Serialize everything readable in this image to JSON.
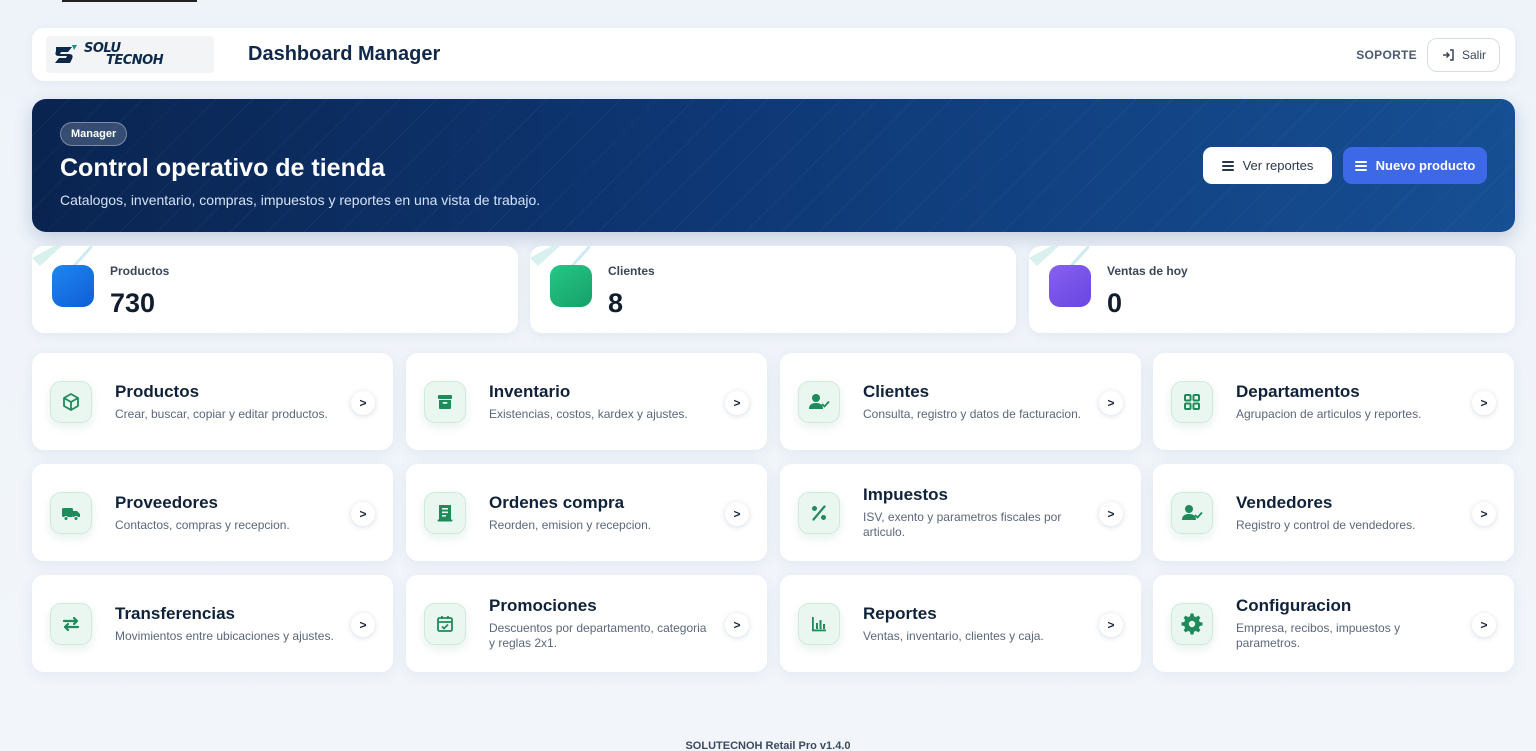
{
  "header": {
    "logo_text_line1": "SOLU",
    "logo_text_line2": "TECNOH",
    "title": "Dashboard Manager",
    "support_label": "SOPORTE",
    "logout_label": "Salir"
  },
  "hero": {
    "badge": "Manager",
    "title": "Control operativo de tienda",
    "subtitle": "Catalogos, inventario, compras, impuestos y reportes en una vista de trabajo.",
    "reports_button": "Ver reportes",
    "new_product_button": "Nuevo producto"
  },
  "stats": [
    {
      "label": "Productos",
      "value": "730",
      "color": "#1a73e8"
    },
    {
      "label": "Clientes",
      "value": "8",
      "color": "#1fb87a"
    },
    {
      "label": "Ventas de hoy",
      "value": "0",
      "color": "#7653ea"
    }
  ],
  "modules": [
    {
      "title": "Productos",
      "desc": "Crear, buscar, copiar y editar productos.",
      "icon": "box-icon",
      "arrow": ">"
    },
    {
      "title": "Inventario",
      "desc": "Existencias, costos, kardex y ajustes.",
      "icon": "archive-icon",
      "arrow": ">"
    },
    {
      "title": "Clientes",
      "desc": "Consulta, registro y datos de facturacion.",
      "icon": "user-check-icon",
      "arrow": ">"
    },
    {
      "title": "Departamentos",
      "desc": "Agrupacion de articulos y reportes.",
      "icon": "grid-icon",
      "arrow": ">"
    },
    {
      "title": "Proveedores",
      "desc": "Contactos, compras y recepcion.",
      "icon": "truck-icon",
      "arrow": ">"
    },
    {
      "title": "Ordenes compra",
      "desc": "Reorden, emision y recepcion.",
      "icon": "receipt-icon",
      "arrow": ">"
    },
    {
      "title": "Impuestos",
      "desc": "ISV, exento y parametros fiscales por articulo.",
      "icon": "percent-icon",
      "arrow": ">"
    },
    {
      "title": "Vendedores",
      "desc": "Registro y control de vendedores.",
      "icon": "user-check-icon",
      "arrow": ">"
    },
    {
      "title": "Transferencias",
      "desc": "Movimientos entre ubicaciones y ajustes.",
      "icon": "swap-icon",
      "arrow": ">"
    },
    {
      "title": "Promociones",
      "desc": "Descuentos por departamento, categoria y reglas 2x1.",
      "icon": "calendar-check-icon",
      "arrow": ">"
    },
    {
      "title": "Reportes",
      "desc": "Ventas, inventario, clientes y caja.",
      "icon": "bar-chart-icon",
      "arrow": ">"
    },
    {
      "title": "Configuracion",
      "desc": "Empresa, recibos, impuestos y parametros.",
      "icon": "gear-icon",
      "arrow": ">"
    }
  ],
  "colors": {
    "accent_green": "#1f8a5a",
    "primary_button": "#3d68e8",
    "hero_dark": "#0a2450"
  },
  "footer": "SOLUTECNOH Retail Pro  v1.4.0"
}
